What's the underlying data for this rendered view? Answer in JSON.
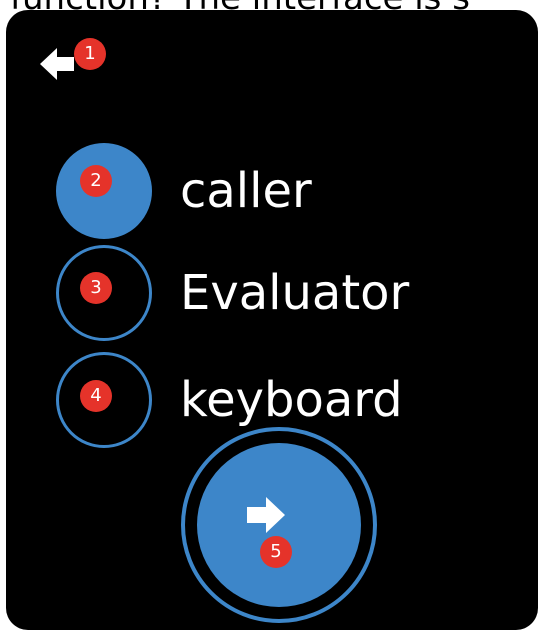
{
  "caption": {
    "text": "function? The interface is s"
  },
  "screen": {
    "back_icon": "arrow-left-icon",
    "options": [
      {
        "label": "caller",
        "selected": true
      },
      {
        "label": "Evaluator",
        "selected": false
      },
      {
        "label": "keyboard",
        "selected": false
      }
    ],
    "confirm_icon": "arrow-right-icon"
  },
  "markers": [
    "1",
    "2",
    "3",
    "4",
    "5"
  ],
  "colors": {
    "accent": "#3d86c9",
    "marker": "#e5332a",
    "background": "#000000",
    "text": "#ffffff"
  }
}
